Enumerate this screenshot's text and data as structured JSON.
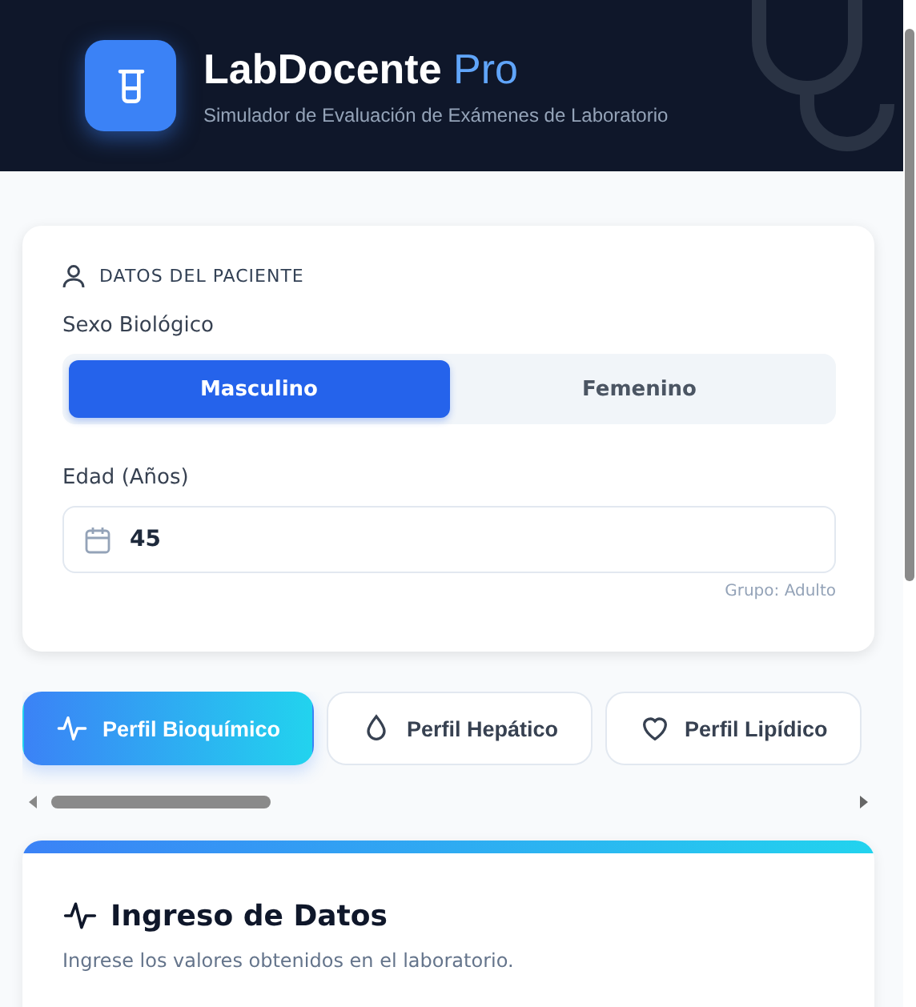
{
  "header": {
    "title": "LabDocente",
    "title_accent": "Pro",
    "subtitle": "Simulador de Evaluación de Exámenes de Laboratorio"
  },
  "patient": {
    "heading": "DATOS DEL PACIENTE",
    "sex_label": "Sexo Biológico",
    "sex_options": [
      {
        "label": "Masculino",
        "selected": true
      },
      {
        "label": "Femenino",
        "selected": false
      }
    ],
    "age_label": "Edad (Años)",
    "age_value": "45",
    "age_group": "Grupo: Adulto"
  },
  "tabs": [
    {
      "label": "Perfil Bioquímico",
      "kind": "pulse",
      "selected": true
    },
    {
      "label": "Perfil Hepático",
      "kind": "drop",
      "selected": false
    },
    {
      "label": "Perfil Lipídico",
      "kind": "heart",
      "selected": false
    }
  ],
  "section": {
    "title": "Ingreso de Datos",
    "subtitle": "Ingrese los valores obtenidos en el laboratorio."
  }
}
